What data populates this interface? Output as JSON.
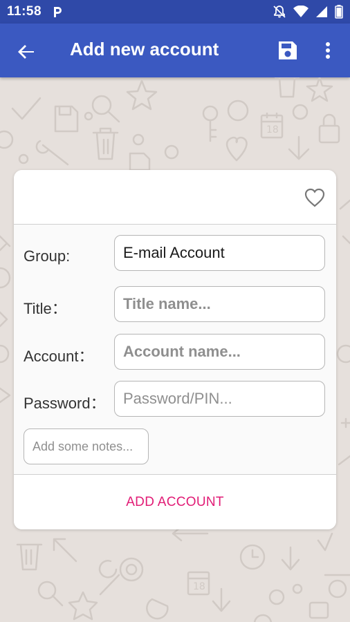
{
  "status_bar": {
    "time": "11:58",
    "icons": [
      "parking-icon",
      "do-not-disturb-icon",
      "wifi-icon",
      "signal-icon",
      "battery-icon"
    ]
  },
  "app_bar": {
    "title": "Add new account",
    "icons": [
      "back-arrow-icon",
      "save-icon",
      "more-vert-icon"
    ]
  },
  "card": {
    "favorite_icon": "heart-outline-icon",
    "group": {
      "label": "Group:",
      "value": "E-mail Account"
    },
    "title": {
      "label": "Title：",
      "placeholder": "Title name..."
    },
    "account": {
      "label": "Account：",
      "placeholder": "Account name..."
    },
    "password": {
      "label": "Password：",
      "placeholder": "Password/PIN..."
    },
    "notes": {
      "placeholder": "Add some notes..."
    },
    "submit_label": "ADD ACCOUNT"
  },
  "colors": {
    "status_bar": "#2f49a8",
    "app_bar": "#3b59c1",
    "accent": "#e11b75",
    "background": "#e6e0dc"
  }
}
